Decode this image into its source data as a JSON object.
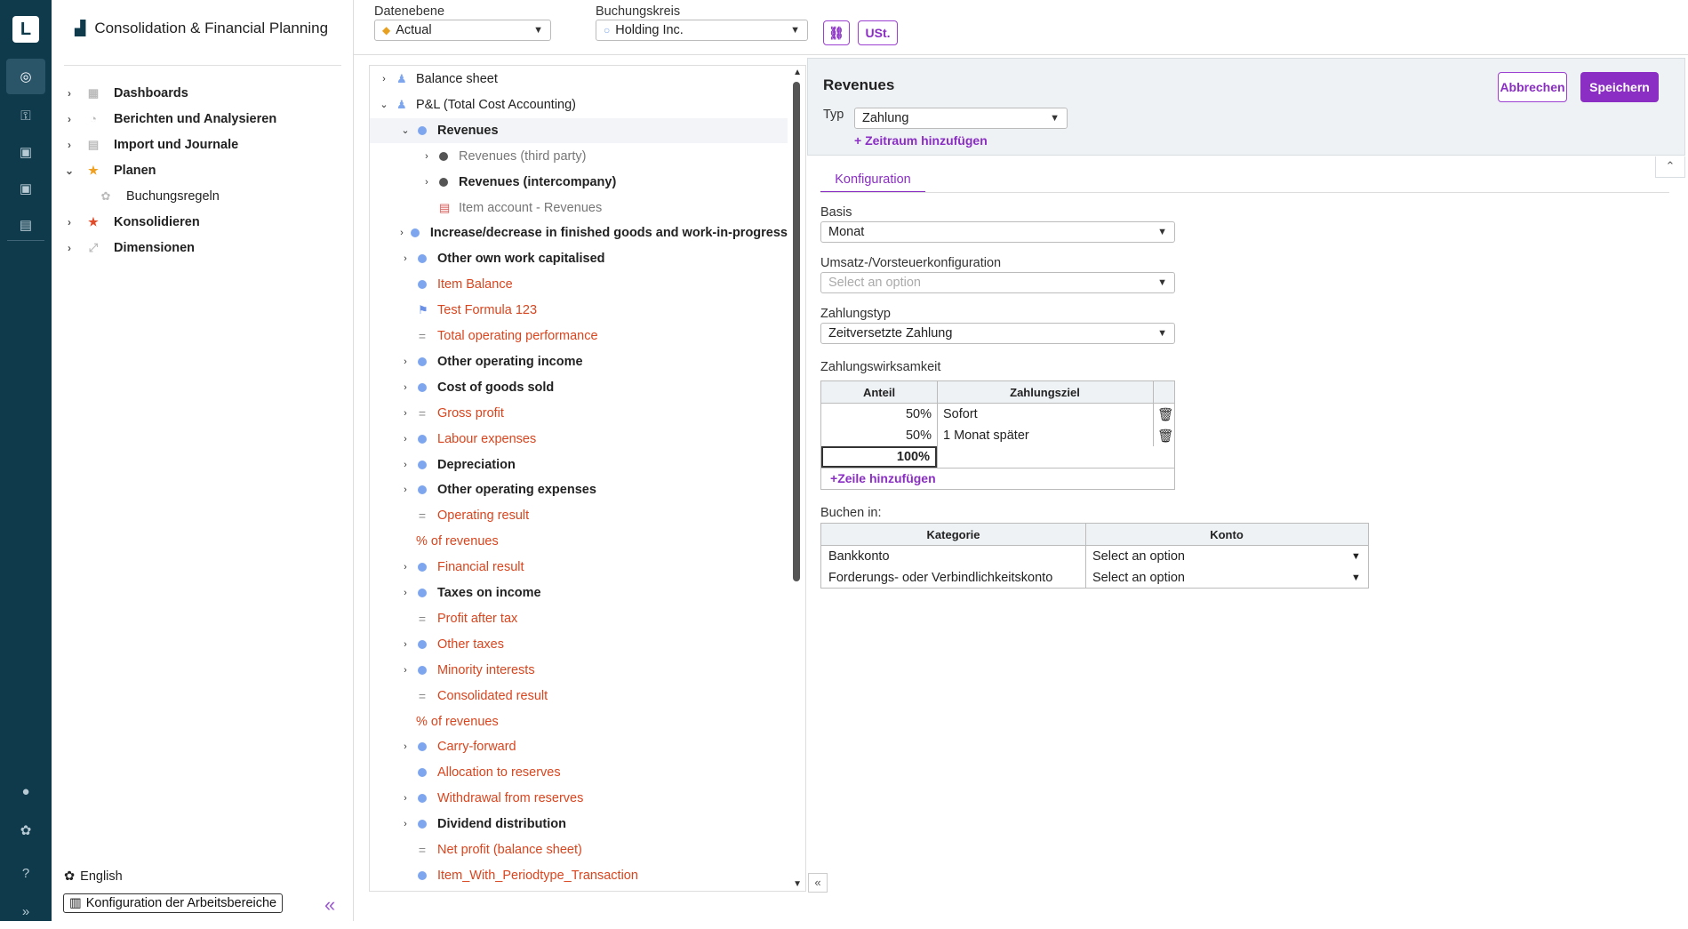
{
  "rail": {
    "logo": "L"
  },
  "sidebar": {
    "app_title": "Consolidation & Financial Planning",
    "items": [
      {
        "label": "Dashboards",
        "chevron": "›",
        "icon": "▦"
      },
      {
        "label": "Berichten und Analysieren",
        "chevron": "›",
        "icon": "◔"
      },
      {
        "label": "Import und Journale",
        "chevron": "›",
        "icon": "▤"
      },
      {
        "label": "Planen",
        "chevron": "⌄",
        "icon": "★"
      },
      {
        "label": "Buchungsregeln",
        "chevron": "",
        "icon": "✿"
      },
      {
        "label": "Konsolidieren",
        "chevron": "›",
        "icon": "★"
      },
      {
        "label": "Dimensionen",
        "chevron": "›",
        "icon": "⤢"
      }
    ],
    "language": "English",
    "workspace_config": "Konfiguration der Arbeitsbereiche"
  },
  "topbar": {
    "datenebene_label": "Datenebene",
    "datenebene_value": "Actual",
    "buchungskreis_label": "Buchungskreis",
    "buchungskreis_value": "Holding Inc.",
    "ust_label": "USt."
  },
  "tree": [
    {
      "label": "Balance sheet",
      "style": "normal",
      "icon": "person",
      "chevron": "›",
      "indent": 0
    },
    {
      "label": "P&L (Total Cost Accounting)",
      "style": "normal",
      "icon": "person",
      "chevron": "⌄",
      "indent": 0
    },
    {
      "label": "Revenues",
      "style": "bold",
      "icon": "dot",
      "chevron": "⌄",
      "indent": 1,
      "selected": true
    },
    {
      "label": "Revenues (third party)",
      "style": "grey",
      "icon": "dot-dark",
      "chevron": "›",
      "indent": 2
    },
    {
      "label": "Revenues (intercompany)",
      "style": "bold",
      "icon": "dot-dark",
      "chevron": "›",
      "indent": 2
    },
    {
      "label": "Item account - Revenues",
      "style": "grey",
      "icon": "acct",
      "chevron": "",
      "indent": 2
    },
    {
      "label": "Increase/decrease in finished goods and work-in-progress",
      "style": "bold",
      "icon": "dot",
      "chevron": "›",
      "indent": 1
    },
    {
      "label": "Other own work capitalised",
      "style": "bold",
      "icon": "dot",
      "chevron": "›",
      "indent": 1
    },
    {
      "label": "Item Balance",
      "style": "red",
      "icon": "dot",
      "chevron": "",
      "indent": 1
    },
    {
      "label": "Test Formula 123",
      "style": "red",
      "icon": "flag",
      "chevron": "",
      "indent": 1
    },
    {
      "label": "Total operating performance",
      "style": "red",
      "icon": "eq",
      "chevron": "",
      "indent": 1
    },
    {
      "label": "Other operating income",
      "style": "bold",
      "icon": "dot",
      "chevron": "›",
      "indent": 1
    },
    {
      "label": "Cost of goods sold",
      "style": "bold",
      "icon": "dot",
      "chevron": "›",
      "indent": 1
    },
    {
      "label": "Gross profit",
      "style": "red",
      "icon": "eq",
      "chevron": "›",
      "indent": 1
    },
    {
      "label": "Labour expenses",
      "style": "red",
      "icon": "dot",
      "chevron": "›",
      "indent": 1
    },
    {
      "label": "Depreciation",
      "style": "bold",
      "icon": "dot",
      "chevron": "›",
      "indent": 1
    },
    {
      "label": "Other operating expenses",
      "style": "bold",
      "icon": "dot",
      "chevron": "›",
      "indent": 1
    },
    {
      "label": "Operating result",
      "style": "red",
      "icon": "eq",
      "chevron": "",
      "indent": 1
    },
    {
      "label": "% of revenues",
      "style": "red",
      "icon": "none",
      "chevron": "",
      "indent": 1
    },
    {
      "label": "Financial result",
      "style": "red",
      "icon": "dot",
      "chevron": "›",
      "indent": 1
    },
    {
      "label": "Taxes on income",
      "style": "bold",
      "icon": "dot",
      "chevron": "›",
      "indent": 1
    },
    {
      "label": "Profit after tax",
      "style": "red",
      "icon": "eq",
      "chevron": "",
      "indent": 1
    },
    {
      "label": "Other taxes",
      "style": "red",
      "icon": "dot",
      "chevron": "›",
      "indent": 1
    },
    {
      "label": "Minority interests",
      "style": "red",
      "icon": "dot",
      "chevron": "›",
      "indent": 1
    },
    {
      "label": "Consolidated result",
      "style": "red",
      "icon": "eq",
      "chevron": "",
      "indent": 1
    },
    {
      "label": "% of revenues",
      "style": "red",
      "icon": "none",
      "chevron": "",
      "indent": 1
    },
    {
      "label": "Carry-forward",
      "style": "red",
      "icon": "dot",
      "chevron": "›",
      "indent": 1
    },
    {
      "label": "Allocation to reserves",
      "style": "red",
      "icon": "dot",
      "chevron": "",
      "indent": 1
    },
    {
      "label": "Withdrawal from reserves",
      "style": "red",
      "icon": "dot",
      "chevron": "›",
      "indent": 1
    },
    {
      "label": "Dividend distribution",
      "style": "bold",
      "icon": "dot",
      "chevron": "›",
      "indent": 1
    },
    {
      "label": "Net profit (balance sheet)",
      "style": "red",
      "icon": "eq",
      "chevron": "",
      "indent": 1
    },
    {
      "label": "Item_With_Periodtype_Transaction",
      "style": "red",
      "icon": "dot",
      "chevron": "",
      "indent": 1
    }
  ],
  "detail": {
    "title": "Revenues",
    "cancel": "Abbrechen",
    "save": "Speichern",
    "typ_label": "Typ",
    "typ_value": "Zahlung",
    "add_period": "Zeitraum hinzufügen",
    "tab": "Konfiguration",
    "basis_label": "Basis",
    "basis_value": "Monat",
    "tax_label": "Umsatz-/Vorsteuerkonfiguration",
    "tax_placeholder": "Select an option",
    "payment_type_label": "Zahlungstyp",
    "payment_type_value": "Zeitversetzte Zahlung",
    "effectiveness_label": "Zahlungswirksamkeit",
    "eff_headers": [
      "Anteil",
      "Zahlungsziel"
    ],
    "eff_rows": [
      {
        "share": "50%",
        "target": "Sofort"
      },
      {
        "share": "50%",
        "target": "1 Monat später"
      }
    ],
    "eff_total": "100%",
    "add_row": "Zeile hinzufügen",
    "book_label": "Buchen in:",
    "book_headers": [
      "Kategorie",
      "Konto"
    ],
    "book_rows": [
      {
        "category": "Bankkonto",
        "account": "Select an option"
      },
      {
        "category": "Forderungs- oder Verbindlichkeitskonto",
        "account": "Select an option"
      }
    ]
  },
  "colors": {
    "accent": "#8a2ec4",
    "rail": "#0f3a4c",
    "formula_red": "#d9451e",
    "node_blue": "#7ea6ef"
  }
}
